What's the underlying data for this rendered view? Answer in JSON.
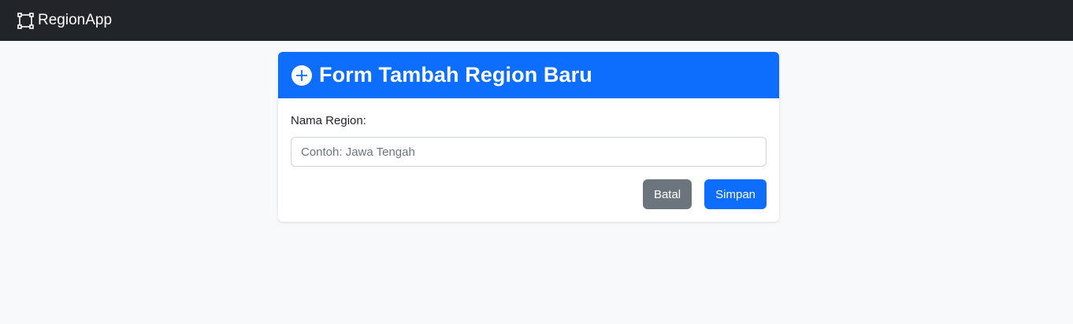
{
  "navbar": {
    "brand": "RegionApp",
    "brand_icon": "bounding-box-icon",
    "background": "#212529"
  },
  "card": {
    "title": "Form Tambah Region Baru",
    "title_icon": "plus-circle-icon",
    "header_color": "#0d6efd"
  },
  "form": {
    "label": "Nama Region:",
    "input_value": "",
    "placeholder": "Contoh: Jawa Tengah"
  },
  "buttons": {
    "cancel_label": "Batal",
    "save_label": "Simpan",
    "cancel_color": "#6c757d",
    "save_color": "#0d6efd"
  }
}
